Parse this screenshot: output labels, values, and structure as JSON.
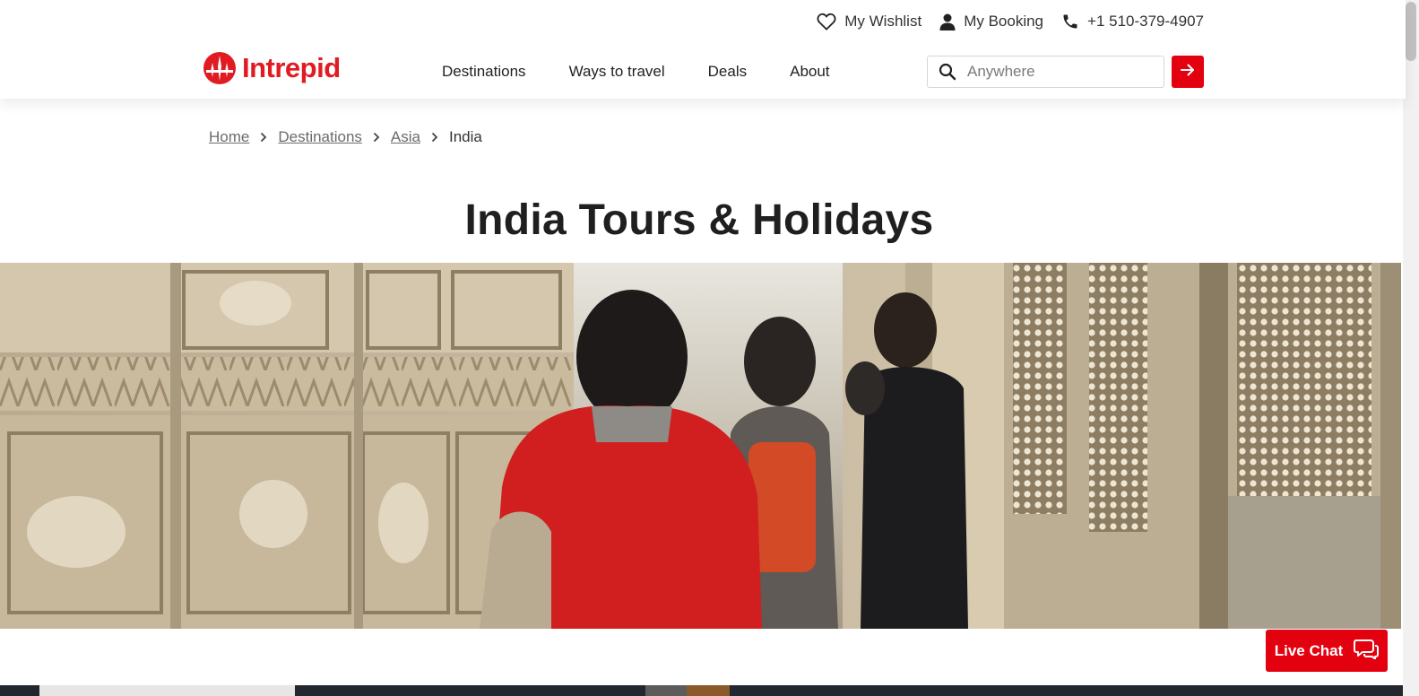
{
  "header": {
    "utility": {
      "wishlist": "My Wishlist",
      "booking": "My Booking",
      "phone": "+1 510-379-4907"
    },
    "logo_text": "Intrepid",
    "nav": [
      "Destinations",
      "Ways to travel",
      "Deals",
      "About"
    ],
    "search": {
      "placeholder": "Anywhere"
    }
  },
  "breadcrumb": {
    "items": [
      "Home",
      "Destinations",
      "Asia"
    ],
    "current": "India"
  },
  "page_title": "India Tours & Holidays",
  "hero": {
    "icon": "photo-travellers-temple"
  },
  "live_chat": {
    "label": "Live Chat"
  },
  "colors": {
    "brand_red": "#e3000f",
    "logo_red": "#e11b22",
    "text_dark": "#1f1f1f",
    "link_gray": "#6b6b6b"
  }
}
